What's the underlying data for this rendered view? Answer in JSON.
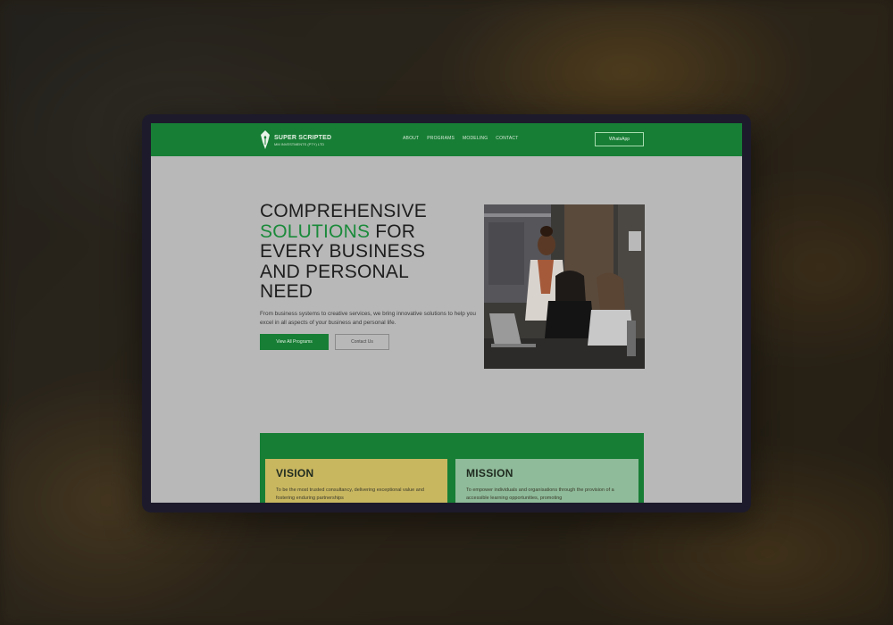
{
  "brand": {
    "name": "SUPER SCRIPTED",
    "tagline": "MM INVESTMENTS (PTY) LTD",
    "accent": "#177e35",
    "logo_icon": "pen-nib-icon"
  },
  "nav": {
    "items": [
      "ABOUT",
      "PROGRAMS",
      "MODELING",
      "CONTACT"
    ],
    "cta": "WhatsApp"
  },
  "hero": {
    "headline_line1": "COMPREHENSIVE",
    "headline_green": "SOLUTIONS",
    "headline_after_green": " FOR",
    "headline_line3": "EVERY BUSINESS",
    "headline_line4": "AND PERSONAL",
    "headline_line5": "NEED",
    "lead": "From business systems to creative services, we bring innovative solutions to help you excel in all aspects of your business and personal life.",
    "primary_button": "View All Programs",
    "secondary_button": "Contact Us"
  },
  "vision": {
    "title": "VISION",
    "text": "To be the most trusted consultancy, delivering exceptional value and fostering enduring partnerships"
  },
  "mission": {
    "title": "MISSION",
    "text": "To empower individuals and organisations through the provision of a accessible learning opportunities, promoting"
  }
}
